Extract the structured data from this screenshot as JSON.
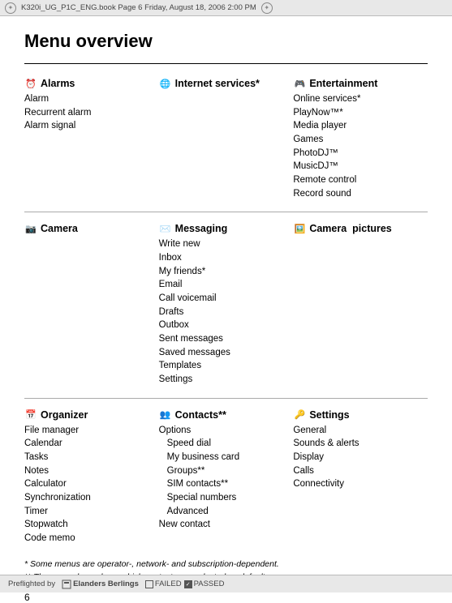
{
  "page": {
    "title": "Menu overview",
    "number": "6",
    "header_text": "K320i_UG_P1C_ENG.book  Page 6  Friday, August 18, 2006  2:00 PM"
  },
  "sections": {
    "row1": [
      {
        "id": "alarms",
        "icon": "alarm",
        "title": "Alarms",
        "items": [
          "Alarm",
          "Recurrent alarm",
          "Alarm signal"
        ]
      },
      {
        "id": "internet",
        "icon": "globe",
        "title": "Internet services*",
        "items": []
      },
      {
        "id": "entertainment",
        "icon": "entertainment",
        "title": "Entertainment",
        "items": [
          "Online services*",
          "PlayNow™*",
          "Media player",
          "Games",
          "PhotoDJ™",
          "MusicDJ™",
          "Remote control",
          "Record sound"
        ]
      }
    ],
    "row2": [
      {
        "id": "camera",
        "icon": "camera",
        "title": "Camera",
        "items": []
      },
      {
        "id": "messaging",
        "icon": "messaging",
        "title": "Messaging",
        "items": [
          "Write new",
          "Inbox",
          "My friends*",
          "Email",
          "Call voicemail",
          "Drafts",
          "Outbox",
          "Sent messages",
          "Saved messages",
          "Templates",
          "Settings"
        ]
      },
      {
        "id": "camera-pictures",
        "icon": "camera",
        "title": "Camera  pictures",
        "items": []
      }
    ],
    "row3": [
      {
        "id": "organizer",
        "icon": "organizer",
        "title": "Organizer",
        "items": [
          "File manager",
          "Calendar",
          "Tasks",
          "Notes",
          "Calculator",
          "Synchronization",
          "Timer",
          "Stopwatch",
          "Code memo"
        ]
      },
      {
        "id": "contacts",
        "icon": "contacts",
        "title": "Contacts**",
        "items": [
          {
            "text": "Options",
            "indent": false
          },
          {
            "text": "Speed dial",
            "indent": true
          },
          {
            "text": "My business card",
            "indent": true
          },
          {
            "text": "Groups**",
            "indent": true
          },
          {
            "text": "SIM contacts**",
            "indent": true
          },
          {
            "text": "Special numbers",
            "indent": true
          },
          {
            "text": "Advanced",
            "indent": true
          },
          {
            "text": "New contact",
            "indent": false
          }
        ]
      },
      {
        "id": "settings",
        "icon": "settings",
        "title": "Settings",
        "items": [
          "General",
          "Sounds & alerts",
          "Display",
          "Calls",
          "Connectivity"
        ]
      }
    ]
  },
  "footnotes": {
    "line1": "* Some menus are operator-, network- and subscription-dependent.",
    "line2": "** The menu depends on which contacts are selected as default."
  },
  "preflight": {
    "text": "Preflighted by",
    "company": "Elanders Berlings",
    "failed_label": "FAILED",
    "passed_label": "PASSED"
  }
}
